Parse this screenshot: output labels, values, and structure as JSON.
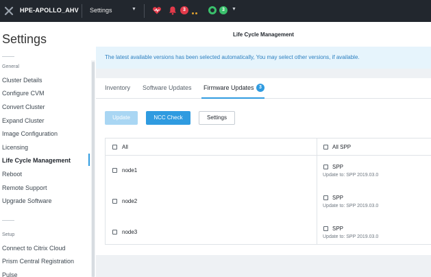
{
  "topbar": {
    "cluster_name": "HPE-APOLLO_AHV",
    "menu_label": "Settings",
    "alert_count": "3",
    "task_count": "3",
    "colors": {
      "bar": "#22272e",
      "alert": "#e23a4a",
      "ok": "#3ac06c",
      "warning": "#e0a230"
    },
    "icons": [
      "nutanix-x-icon",
      "chevron-down-icon",
      "heart-health-icon",
      "bell-icon",
      "status-ring-icon"
    ]
  },
  "sidebar": {
    "title": "Settings",
    "sections": [
      {
        "label": "General",
        "items": [
          "Cluster Details",
          "Configure CVM",
          "Convert Cluster",
          "Expand Cluster",
          "Image Configuration",
          "Licensing",
          "Life Cycle Management",
          "Reboot",
          "Remote Support",
          "Upgrade Software"
        ]
      },
      {
        "label": "Setup",
        "items": [
          "Connect to Citrix Cloud",
          "Prism Central Registration",
          "Pulse"
        ]
      }
    ],
    "active_item": "Life Cycle Management"
  },
  "main": {
    "page_title": "Life Cycle Management",
    "banner": "The latest available versions has been selected automatically, You may select other versions, if available.",
    "tabs": [
      {
        "label": "Inventory"
      },
      {
        "label": "Software Updates"
      },
      {
        "label": "Firmware Updates",
        "badge": "3"
      }
    ],
    "active_tab": "Firmware Updates",
    "buttons": {
      "update": "Update",
      "ncc_check": "NCC Check",
      "settings": "Settings"
    },
    "table": {
      "header_left": "All",
      "header_right": "All SPP",
      "rows": [
        {
          "node": "node1",
          "component": "SPP",
          "update_text": "Update to: SPP 2019.03.0"
        },
        {
          "node": "node2",
          "component": "SPP",
          "update_text": "Update to: SPP 2019.03.0"
        },
        {
          "node": "node3",
          "component": "SPP",
          "update_text": "Update to: SPP 2019.03.0"
        }
      ]
    },
    "accent_color": "#2f9be0"
  }
}
